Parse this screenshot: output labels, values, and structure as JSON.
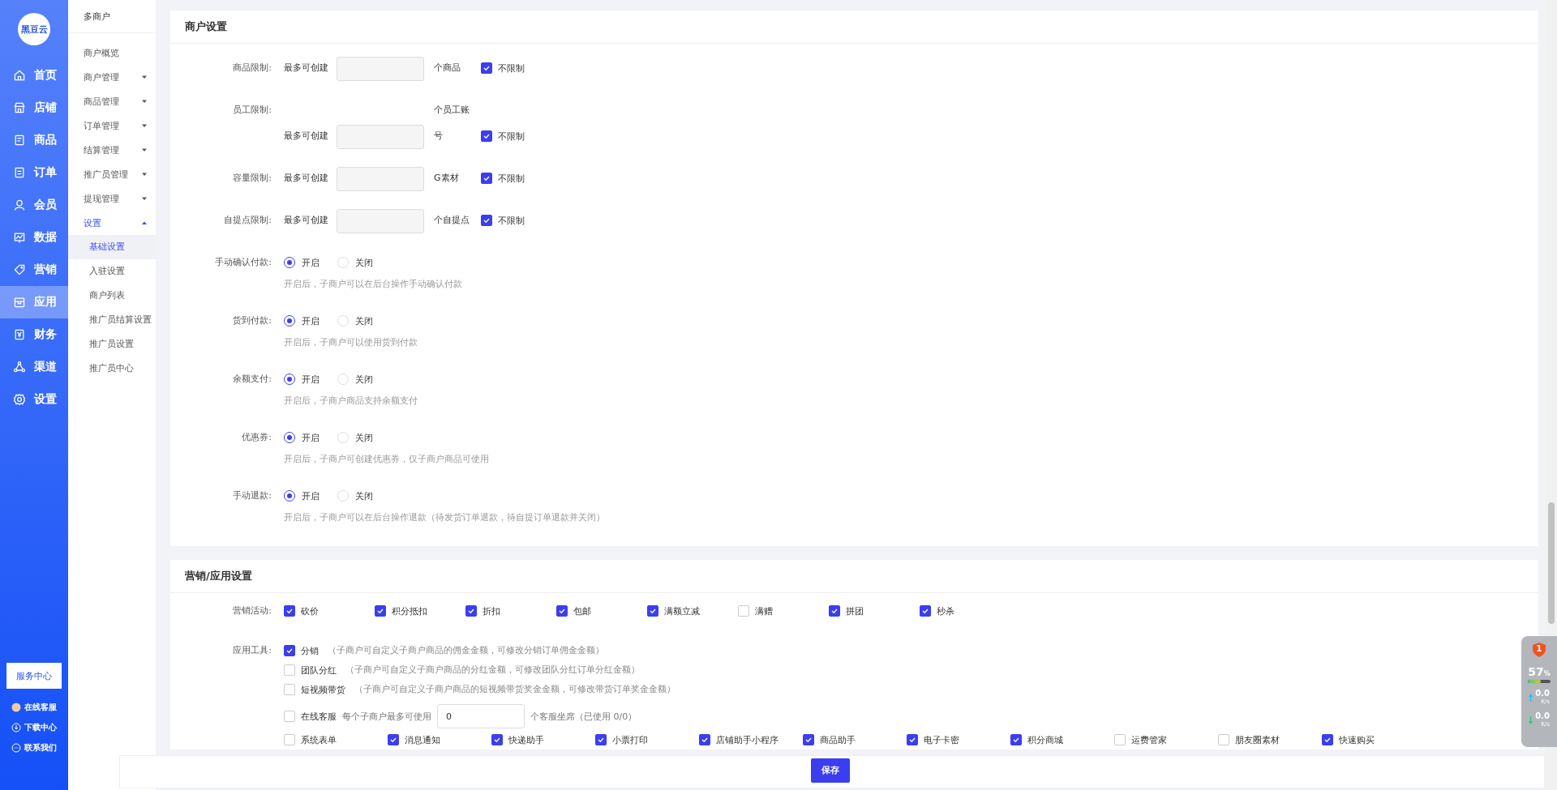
{
  "sidebar": {
    "logo": "黑豆云",
    "items": [
      {
        "label": "首页",
        "selected": false
      },
      {
        "label": "店铺",
        "selected": false
      },
      {
        "label": "商品",
        "selected": false
      },
      {
        "label": "订单",
        "selected": false
      },
      {
        "label": "会员",
        "selected": false
      },
      {
        "label": "数据",
        "selected": false
      },
      {
        "label": "营销",
        "selected": false
      },
      {
        "label": "应用",
        "selected": true
      },
      {
        "label": "财务",
        "selected": false
      },
      {
        "label": "渠道",
        "selected": false
      },
      {
        "label": "设置",
        "selected": false
      }
    ],
    "service_button": "服务中心",
    "links": [
      "在线客服",
      "下载中心",
      "联系我们"
    ]
  },
  "submenu": {
    "title": "多商户",
    "items": [
      {
        "label": "商户概览",
        "kind": "link"
      },
      {
        "label": "商户管理",
        "kind": "group",
        "expanded": false
      },
      {
        "label": "商品管理",
        "kind": "group",
        "expanded": false
      },
      {
        "label": "订单管理",
        "kind": "group",
        "expanded": false
      },
      {
        "label": "结算管理",
        "kind": "group",
        "expanded": false
      },
      {
        "label": "推广员管理",
        "kind": "group",
        "expanded": false
      },
      {
        "label": "提现管理",
        "kind": "group",
        "expanded": false
      },
      {
        "label": "设置",
        "kind": "group",
        "expanded": true,
        "children": [
          {
            "label": "基础设置",
            "selected": true
          },
          {
            "label": "入驻设置",
            "selected": false
          },
          {
            "label": "商户列表",
            "selected": false
          },
          {
            "label": "推广员结算设置",
            "selected": false
          },
          {
            "label": "推广员设置",
            "selected": false
          },
          {
            "label": "推广员中心",
            "selected": false
          }
        ]
      }
    ]
  },
  "merchant_settings": {
    "title": "商户设置",
    "limits": [
      {
        "label": "商品限制:",
        "prefix": "最多可创建",
        "unit": "个商品",
        "unlimited_label": "不限制",
        "unlimited": true
      },
      {
        "label": "员工限制:",
        "prefix": "最多可创建",
        "unit": "个员工账号",
        "unlimited_label": "不限制",
        "unlimited": true
      },
      {
        "label": "容量限制:",
        "prefix": "最多可创建",
        "unit": "G素材",
        "unlimited_label": "不限制",
        "unlimited": true
      },
      {
        "label": "自提点限制:",
        "prefix": "最多可创建",
        "unit": "个自提点",
        "unlimited_label": "不限制",
        "unlimited": true
      }
    ],
    "toggles": [
      {
        "label": "手动确认付款:",
        "options": [
          {
            "label": "开启",
            "selected": true
          },
          {
            "label": "关闭",
            "selected": false
          }
        ],
        "hint": "开启后，子商户可以在后台操作手动确认付款"
      },
      {
        "label": "货到付款:",
        "options": [
          {
            "label": "开启",
            "selected": true
          },
          {
            "label": "关闭",
            "selected": false
          }
        ],
        "hint": "开启后，子商户可以使用货到付款"
      },
      {
        "label": "余额支付:",
        "options": [
          {
            "label": "开启",
            "selected": true
          },
          {
            "label": "关闭",
            "selected": false
          }
        ],
        "hint": "开启后，子商户商品支持余额支付"
      },
      {
        "label": "优惠券:",
        "options": [
          {
            "label": "开启",
            "selected": true
          },
          {
            "label": "关闭",
            "selected": false
          }
        ],
        "hint": "开启后，子商户可创建优惠券，仅子商户商品可使用"
      },
      {
        "label": "手动退款:",
        "options": [
          {
            "label": "开启",
            "selected": true
          },
          {
            "label": "关闭",
            "selected": false
          }
        ],
        "hint": "开启后，子商户可以在后台操作退款（待发货订单退款，待自提订单退款并关闭）"
      }
    ]
  },
  "marketing_settings": {
    "title": "营销/应用设置",
    "activities": {
      "label": "营销活动:",
      "items": [
        {
          "label": "砍价",
          "checked": true
        },
        {
          "label": "积分抵扣",
          "checked": true
        },
        {
          "label": "折扣",
          "checked": true
        },
        {
          "label": "包邮",
          "checked": true
        },
        {
          "label": "满额立减",
          "checked": true
        },
        {
          "label": "满赠",
          "checked": false
        },
        {
          "label": "拼团",
          "checked": true
        },
        {
          "label": "秒杀",
          "checked": true
        }
      ]
    },
    "tools": {
      "label": "应用工具:",
      "items": [
        {
          "kind": "note",
          "label": "分销",
          "checked": true,
          "note": "（子商户可自定义子商户商品的佣金金额，可修改分销订单佣金金额）"
        },
        {
          "kind": "note",
          "label": "团队分红",
          "checked": false,
          "note": "（子商户可自定义子商户商品的分红金额，可修改团队分红订单分红金额）"
        },
        {
          "kind": "note",
          "label": "短视频带货",
          "checked": false,
          "note": "（子商户可自定义子商户商品的短视频带货奖金金额，可修改带货订单奖金金额）"
        },
        {
          "kind": "seats",
          "label": "在线客服",
          "checked": false,
          "before": "每个子商户最多可使用",
          "value": "0",
          "after": "个客服坐席（已使用 0/0）"
        }
      ],
      "grid": [
        {
          "label": "系统表单",
          "checked": false
        },
        {
          "label": "消息通知",
          "checked": true
        },
        {
          "label": "快递助手",
          "checked": true
        },
        {
          "label": "小票打印",
          "checked": true
        },
        {
          "label": "店铺助手小程序",
          "checked": true
        },
        {
          "label": "商品助手",
          "checked": true
        },
        {
          "label": "电子卡密",
          "checked": true
        },
        {
          "label": "积分商城",
          "checked": true
        },
        {
          "label": "运费管家",
          "checked": false
        },
        {
          "label": "朋友圈素材",
          "checked": false
        },
        {
          "label": "快速购买",
          "checked": true
        }
      ]
    }
  },
  "footer": {
    "save": "保存"
  },
  "speed_widget": {
    "alerts": "1",
    "percent": "57",
    "percent_unit": "%",
    "level": 0.57,
    "up": "0.0",
    "up_unit": "K/s",
    "down": "0.0",
    "down_unit": "K/s"
  }
}
